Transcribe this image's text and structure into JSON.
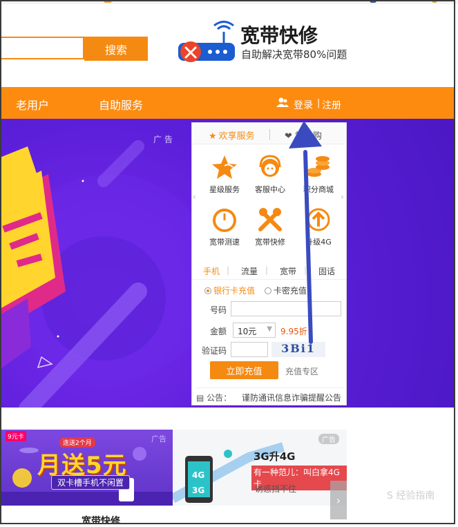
{
  "search": {
    "button": "搜索",
    "placeholder": ""
  },
  "logo": {
    "title": "宽带快修",
    "subtitle": "自助解决宽带80%问题",
    "icon": "router-wrench-icon"
  },
  "nav": {
    "items": [
      "老用户",
      "自助服务"
    ],
    "login": "登录",
    "separator": "|",
    "register": "注册"
  },
  "banner": {
    "ad_tag": "广 告"
  },
  "panel": {
    "tabs": [
      "欢享服务",
      "掌上购"
    ],
    "services": [
      {
        "label": "星级服务",
        "icon": "star-icon"
      },
      {
        "label": "客服中心",
        "icon": "headset-icon"
      },
      {
        "label": "积分商城",
        "icon": "coins-icon"
      },
      {
        "label": "宽带测速",
        "icon": "speedometer-icon"
      },
      {
        "label": "宽带快修",
        "icon": "tools-icon"
      },
      {
        "label": "升级4G",
        "icon": "upgrade-icon"
      }
    ],
    "recharge_tabs": [
      "手机",
      "流量",
      "宽带",
      "固话"
    ],
    "radio_options": [
      "银行卡充值",
      "卡密充值"
    ],
    "form": {
      "number_label": "号码",
      "amount_label": "金额",
      "amount_value": "10元",
      "discount": "9.95折",
      "captcha_label": "验证码",
      "captcha_text": "3Bi1"
    },
    "pay_button": "立即充值",
    "zone_link": "充值专区",
    "notice_label": "公告：",
    "notice_text": "谨防通讯信息诈骗提醒公告"
  },
  "tiles": {
    "tile1": {
      "badge": "9元卡",
      "top": "连送2个月",
      "main": "月送5元",
      "sub": "双卡槽手机不闲置",
      "ad": "广告"
    },
    "tile2": {
      "ad": "广告",
      "title": "3G升4G",
      "red": "有一种范儿：叫白拿4G卡",
      "sub": "诱惑挡不住"
    }
  },
  "bottom_text": "宽带快修",
  "watermark": "S 经验指南",
  "colors": {
    "brand_orange": "#fd8b10",
    "banner_purple": "#5c1fd9",
    "annotation_arrow": "#3a4bc0"
  }
}
